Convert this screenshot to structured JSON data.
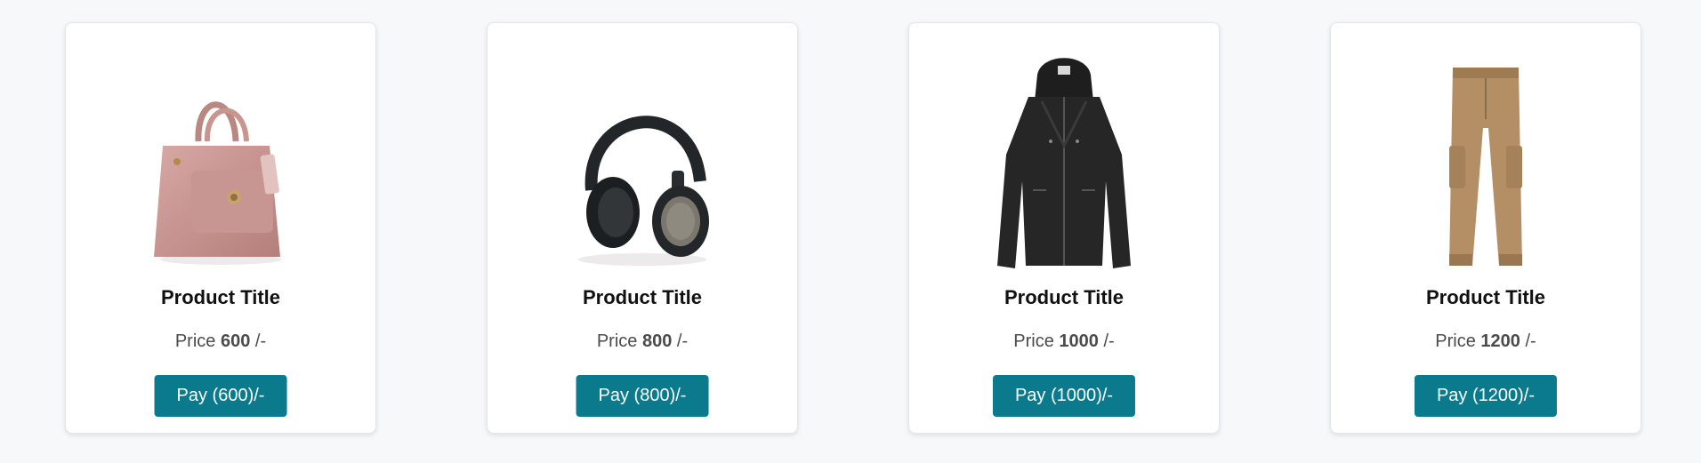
{
  "products": [
    {
      "title": "Product Title",
      "price_prefix": "Price",
      "price": "600",
      "price_suffix": "/-",
      "pay_label": "Pay (600)/-",
      "image_icon": "handbag-icon"
    },
    {
      "title": "Product Title",
      "price_prefix": "Price",
      "price": "800",
      "price_suffix": "/-",
      "pay_label": "Pay (800)/-",
      "image_icon": "headphones-icon"
    },
    {
      "title": "Product Title",
      "price_prefix": "Price",
      "price": "1000",
      "price_suffix": "/-",
      "pay_label": "Pay (1000)/-",
      "image_icon": "jacket-icon"
    },
    {
      "title": "Product Title",
      "price_prefix": "Price",
      "price": "1200",
      "price_suffix": "/-",
      "pay_label": "Pay (1200)/-",
      "image_icon": "cargo-pants-icon"
    }
  ],
  "colors": {
    "button_bg": "#0a7a8c",
    "page_bg": "#f7f8fa"
  }
}
